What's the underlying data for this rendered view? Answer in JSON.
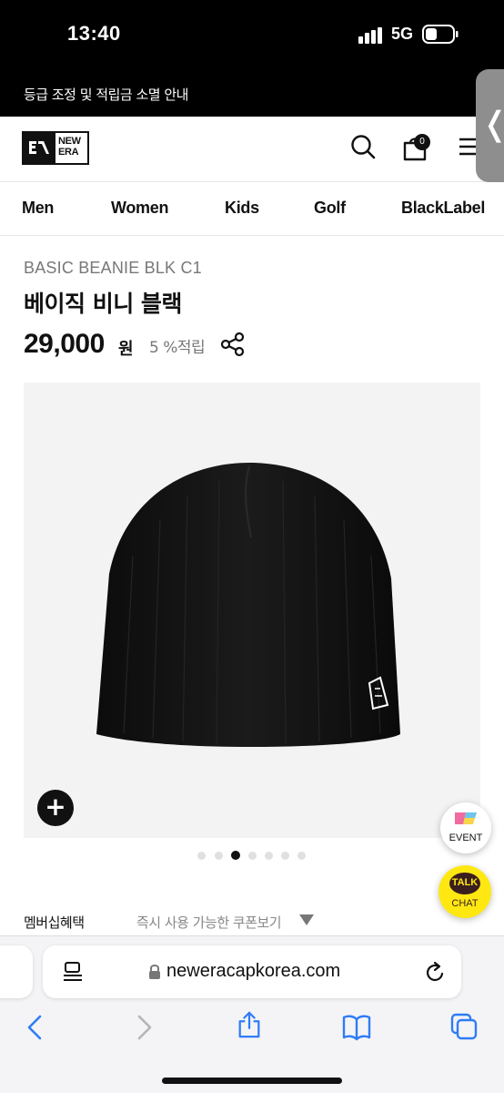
{
  "status_bar": {
    "time": "13:40",
    "network": "5G"
  },
  "notice": {
    "text": "등급 조정 및 적립금 소멸 안내"
  },
  "header": {
    "logo_text": "NEW ERA",
    "cart_count": "0",
    "icons": [
      "search-icon",
      "cart-icon",
      "menu-icon"
    ]
  },
  "nav": {
    "items": [
      {
        "label": "Men"
      },
      {
        "label": "Women"
      },
      {
        "label": "Kids"
      },
      {
        "label": "Golf"
      },
      {
        "label": "BlackLabel"
      }
    ]
  },
  "product": {
    "code": "BASIC BEANIE BLK C1",
    "name": "베이직 비니 블랙",
    "price": "29,000",
    "currency": "원",
    "points": "5 %적립",
    "image_count": 7,
    "active_image_index": 2
  },
  "membership": {
    "label": "멤버십혜택",
    "coupon_link": "즉시 사용 가능한 쿠폰보기"
  },
  "floating": {
    "event_label": "EVENT",
    "talk_bubble": "TALK",
    "talk_label": "CHAT"
  },
  "browser": {
    "url": "neweracapkorea.com",
    "accent_color": "#2f7cf6"
  }
}
